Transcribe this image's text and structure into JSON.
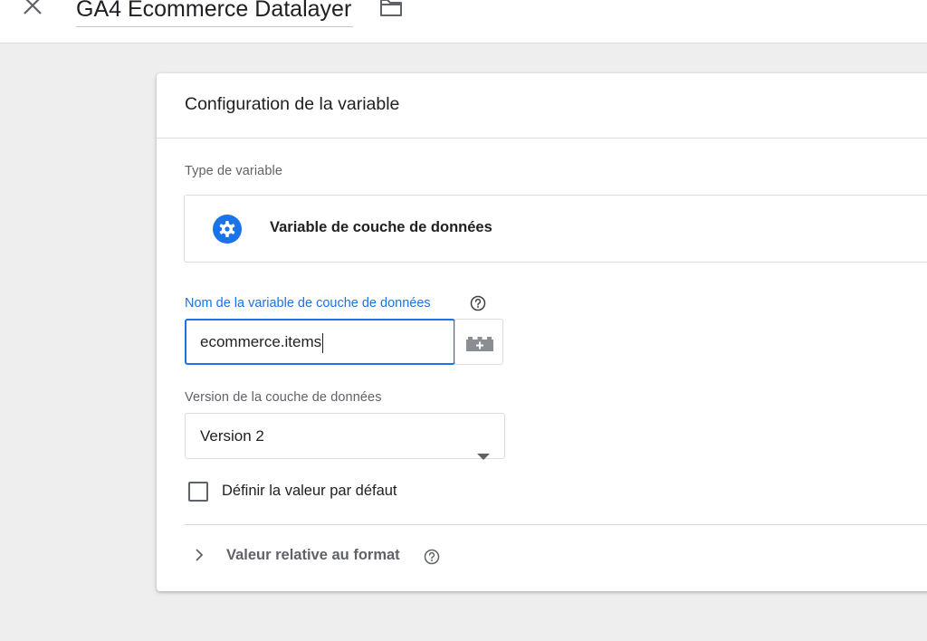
{
  "header": {
    "title": "GA4 Ecommerce Datalayer",
    "close_icon": "close-icon",
    "folder_icon": "folder-icon"
  },
  "card": {
    "title": "Configuration de la variable",
    "variable_type": {
      "label": "Type de variable",
      "icon": "gear-icon",
      "name": "Variable de couche de données"
    },
    "data_layer_name": {
      "label": "Nom de la variable de couche de données",
      "value": "ecommerce.items",
      "help_icon": "help-icon",
      "add_variable_icon": "lego-brick-plus-icon"
    },
    "version": {
      "label": "Version de la couche de données",
      "selected": "Version 2"
    },
    "default_value_checkbox": {
      "label": "Définir la valeur par défaut",
      "checked": false
    },
    "format_section": {
      "label": "Valeur relative au format",
      "expanded": false
    }
  },
  "colors": {
    "accent": "#1a73e8",
    "background": "#eeeeee",
    "card": "#ffffff",
    "muted_text": "#5f6368"
  }
}
